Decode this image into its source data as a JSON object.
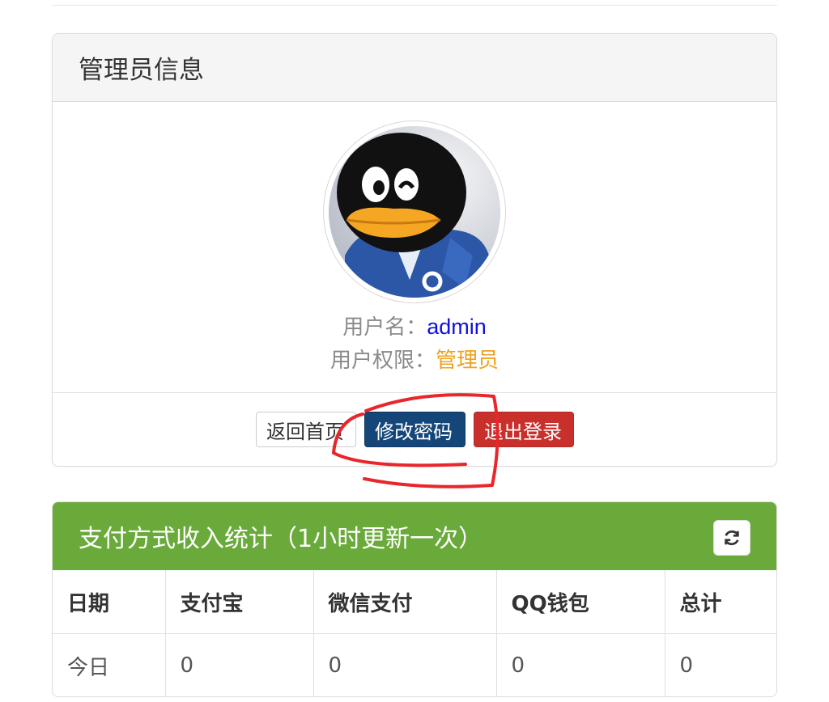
{
  "admin_panel": {
    "title": "管理员信息",
    "username_label": "用户名：",
    "username_value": "admin",
    "role_label": "用户权限：",
    "role_value": "管理员",
    "buttons": {
      "home": "返回首页",
      "change_password": "修改密码",
      "logout": "退出登录"
    },
    "avatar_icon": "qq-penguin-avatar"
  },
  "stats_panel": {
    "title": "支付方式收入统计（1小时更新一次）",
    "refresh_icon": "refresh-icon",
    "headers": [
      "日期",
      "支付宝",
      "微信支付",
      "QQ钱包",
      "总计"
    ],
    "rows": [
      [
        "今日",
        "0",
        "0",
        "0",
        "0"
      ]
    ]
  },
  "colors": {
    "primary_button": "#14467a",
    "danger_button": "#c9302c",
    "stats_header": "#6aaa3a",
    "username_value": "#1010e0",
    "role_value": "#f0a020",
    "annotation_scribble": "#e8262b"
  }
}
